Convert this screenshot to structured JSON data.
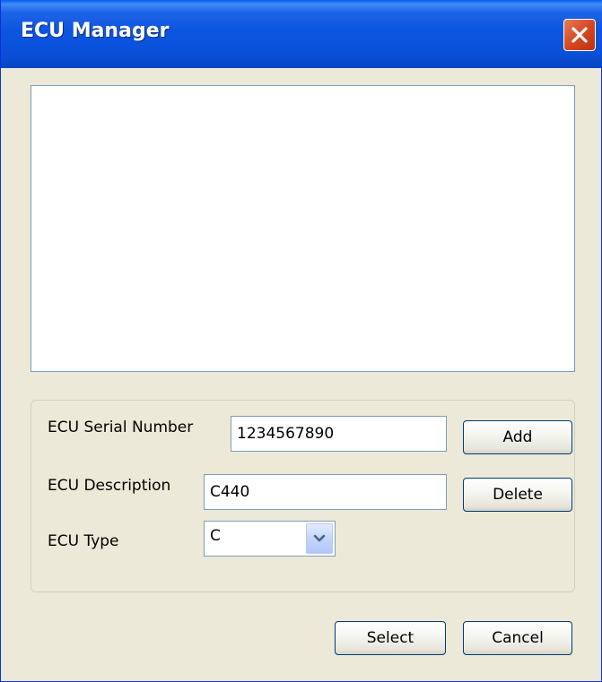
{
  "window": {
    "title": "ECU Manager"
  },
  "ecu_list": {
    "items": []
  },
  "form": {
    "serial_number_label": "ECU Serial Number",
    "serial_number_value": "1234567890",
    "description_label": "ECU Description",
    "description_value": "C440",
    "type_label": "ECU Type",
    "type_value": "C"
  },
  "buttons": {
    "add": "Add",
    "delete": "Delete",
    "select": "Select",
    "cancel": "Cancel"
  },
  "icons": {
    "close": "close-icon",
    "dropdown": "chevron-down-icon"
  }
}
